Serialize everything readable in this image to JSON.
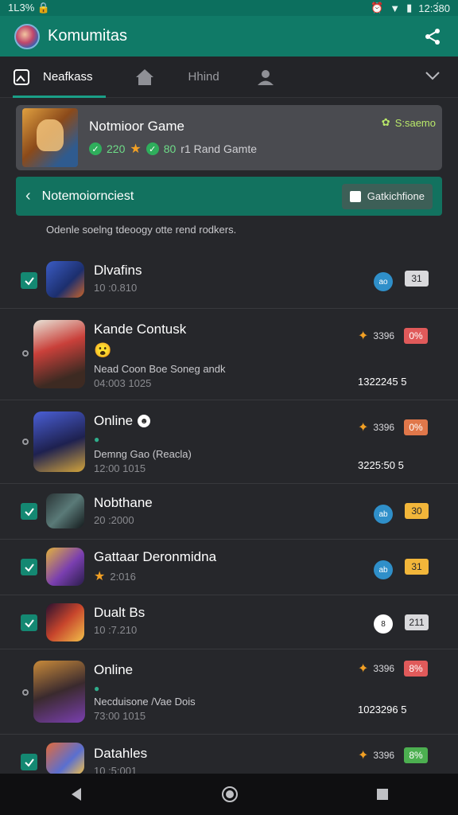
{
  "status_bar": {
    "left": "1L3% 🔒",
    "time": "12:3́80"
  },
  "app": {
    "title": "Komumitas"
  },
  "tabs": [
    {
      "label": "Neafkass",
      "icon": "image-icon",
      "active": true
    },
    {
      "label": "",
      "icon": "house-icon",
      "active": false
    },
    {
      "label": "Hhind",
      "icon": "",
      "active": false
    },
    {
      "label": "",
      "icon": "profile-icon",
      "active": false
    }
  ],
  "featured": {
    "title": "Notmioor Game",
    "count_a": "220",
    "count_b": "80",
    "meta_text": "r1 Rand Gamte",
    "right_text": "S:saemo"
  },
  "banner": {
    "title": "Notemoiornciest",
    "button_label": "Gatkichfione"
  },
  "description": "Odenle soelng tdeoogy otte rend rodkers.",
  "items": [
    {
      "title": "Dlvafins",
      "subtitle": "10 :0.810",
      "check": "box",
      "right_icon": "ao",
      "right_icon_color": "#2f8fc9",
      "badge": "31",
      "badge_color": "#d9d9dc"
    },
    {
      "title": "Kandе Contusk",
      "line2": "😮",
      "desc": "Nеad Coon Boe Soneg andk",
      "subtitle": "04:003 1025",
      "check": "dot",
      "stat": "3396",
      "badge": "0%",
      "badge_color": "#e05a5a",
      "total": "1322245 5"
    },
    {
      "title": "Online",
      "desc": "Demng Gao (Reacla)",
      "subtitle": "12:00 1015",
      "check": "dot",
      "stat": "3396",
      "badge": "0%",
      "badge_color": "#e0774a",
      "total": "3225:50 5"
    },
    {
      "title": "Nobthane",
      "subtitle": "20 :2000",
      "check": "box",
      "right_icon": "ab",
      "right_icon_color": "#2f8fc9",
      "badge": "30",
      "badge_color": "#f2b63a"
    },
    {
      "title": "Gattaar Deronmidna",
      "subtitle": "2:016",
      "check": "box",
      "right_icon": "ab",
      "right_icon_color": "#2f8fc9",
      "badge": "31",
      "badge_color": "#f2b63a"
    },
    {
      "title": "Dualt Bs",
      "subtitle": "10 :7.210",
      "check": "box",
      "right_icon": "8",
      "right_icon_color": "#ffffff",
      "badge": "211",
      "badge_color": "#d9d9dc"
    },
    {
      "title": "Online",
      "desc": "Necduisone /Vae Dois",
      "subtitle": "73:00 1015",
      "check": "dot",
      "stat": "3396",
      "badge": "8%",
      "badge_color": "#e05a5a",
      "total": "1023296 5"
    },
    {
      "title": "Datahles",
      "subtitle": "10 :5:001",
      "check": "box",
      "stat": "3396",
      "badge": "8%",
      "badge_color": "#4caf50"
    }
  ],
  "nav": {
    "back": "◀",
    "home": "◉",
    "recents": "■"
  }
}
